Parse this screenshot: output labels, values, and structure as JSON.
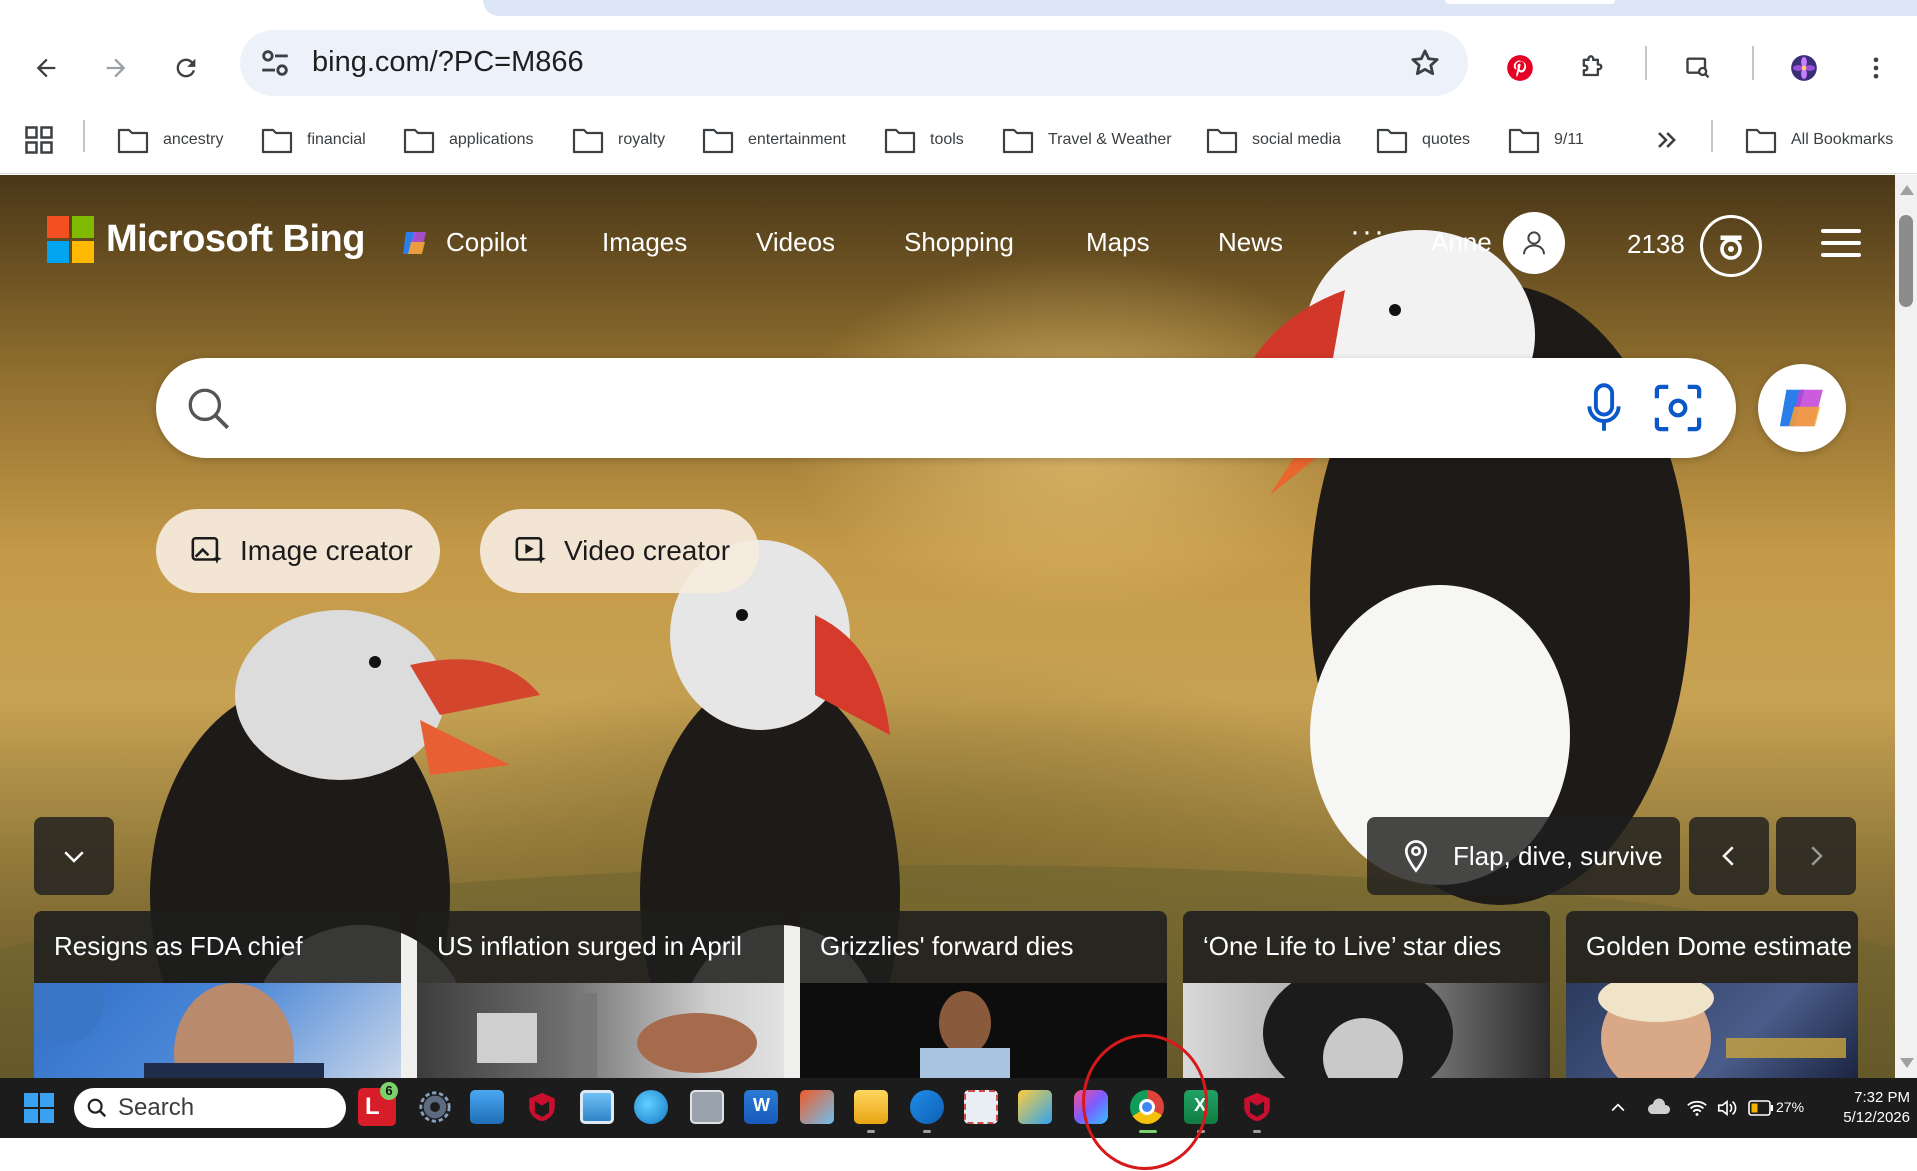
{
  "browser": {
    "url": "bing.com/?PC=M866",
    "bookmarks": [
      "ancestry",
      "financial",
      "applications",
      "royalty",
      "entertainment",
      "tools",
      "Travel & Weather",
      "social media",
      "quotes",
      "9/11"
    ],
    "all_bookmarks_label": "All Bookmarks"
  },
  "bing": {
    "logo_text": "Microsoft Bing",
    "nav": [
      "Copilot",
      "Images",
      "Videos",
      "Shopping",
      "Maps",
      "News"
    ],
    "more_label": "···",
    "user_name": "Anne",
    "points": "2138",
    "search_placeholder": "",
    "creators": [
      "Image creator",
      "Video creator"
    ],
    "location_caption": "Flap, dive, survive",
    "news": [
      "Resigns as FDA chief",
      "US inflation surged in April",
      "Grizzlies' forward dies",
      "‘One Life to Live’ star dies",
      "Golden Dome estimate"
    ]
  },
  "taskbar": {
    "search_label": "Search",
    "notification_badge": "6",
    "battery": "27%",
    "time": "7:32 PM",
    "date": "5/12/2026"
  },
  "colors": {
    "accent_blue": "#0a58ca",
    "taskbar_bg": "#1c1c1c",
    "highlight_circle": "#d7191b"
  }
}
